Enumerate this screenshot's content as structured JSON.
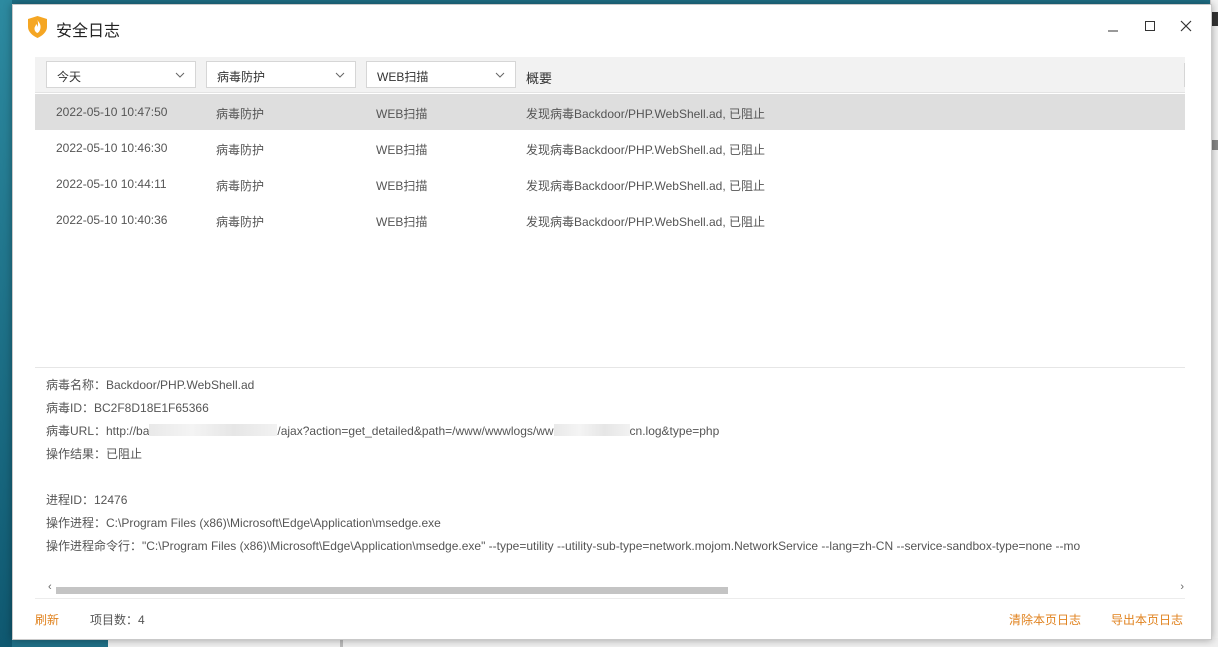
{
  "window": {
    "title": "安全日志"
  },
  "filters": {
    "time": "今天",
    "category": "病毒防护",
    "type": "WEB扫描",
    "summary_header": "概要"
  },
  "rows": [
    {
      "time": "2022-05-10 10:47:50",
      "category": "病毒防护",
      "type": "WEB扫描",
      "summary": "发现病毒Backdoor/PHP.WebShell.ad, 已阻止"
    },
    {
      "time": "2022-05-10 10:46:30",
      "category": "病毒防护",
      "type": "WEB扫描",
      "summary": "发现病毒Backdoor/PHP.WebShell.ad, 已阻止"
    },
    {
      "time": "2022-05-10 10:44:11",
      "category": "病毒防护",
      "type": "WEB扫描",
      "summary": "发现病毒Backdoor/PHP.WebShell.ad, 已阻止"
    },
    {
      "time": "2022-05-10 10:40:36",
      "category": "病毒防护",
      "type": "WEB扫描",
      "summary": "发现病毒Backdoor/PHP.WebShell.ad, 已阻止"
    }
  ],
  "detail": {
    "virus_name": "病毒名称：Backdoor/PHP.WebShell.ad",
    "virus_id": "病毒ID：BC2F8D18E1F65366",
    "url_prefix": "病毒URL：http://ba",
    "url_middle": "/ajax?action=get_detailed&path=/www/wwwlogs/ww",
    "url_suffix": "cn.log&type=php",
    "result": "操作结果：已阻止",
    "pid": "进程ID：12476",
    "process": "操作进程：C:\\Program Files (x86)\\Microsoft\\Edge\\Application\\msedge.exe",
    "cmdline": "操作进程命令行：\"C:\\Program Files (x86)\\Microsoft\\Edge\\Application\\msedge.exe\" --type=utility --utility-sub-type=network.mojom.NetworkService --lang=zh-CN --service-sandbox-type=none --mo"
  },
  "footer": {
    "refresh": "刷新",
    "count": "项目数：4",
    "clear": "清除本页日志",
    "export": "导出本页日志"
  },
  "colors": {
    "accent": "#e0821e",
    "selected_row": "#dedede",
    "header_bg": "#f2f2f2"
  },
  "scroll": {
    "horizontal_position": 0,
    "visible_fraction": 0.6
  }
}
